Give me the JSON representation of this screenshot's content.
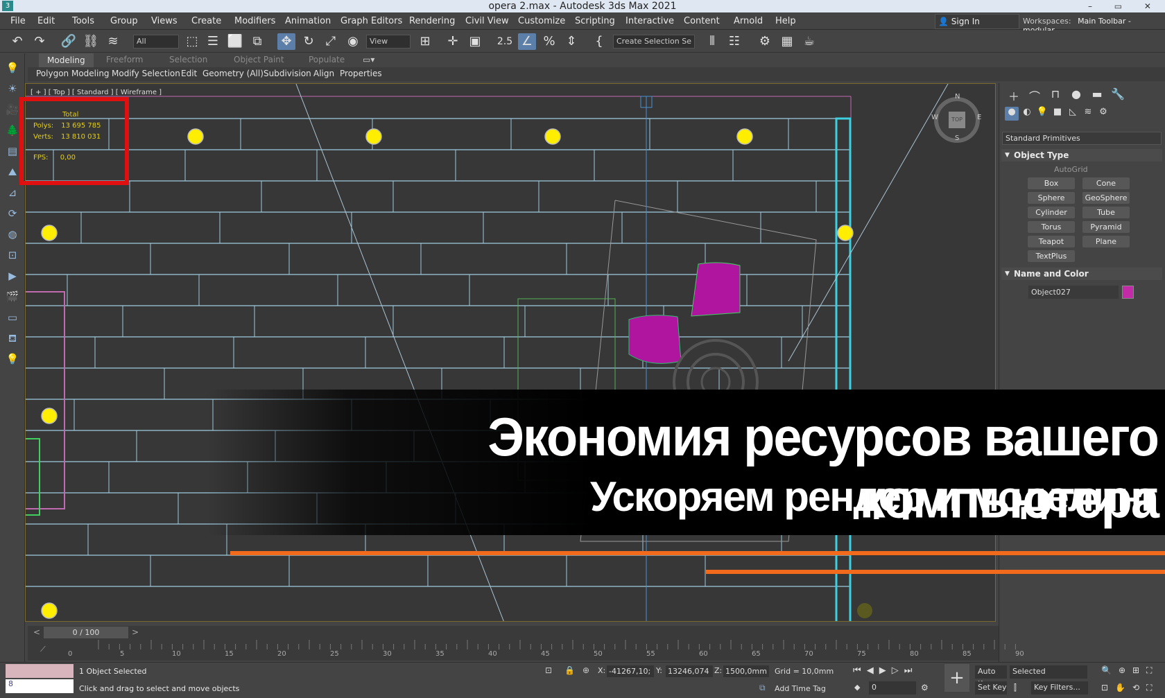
{
  "titlebar": {
    "title": "opera 2.max - Autodesk 3ds Max 2021",
    "app_icon": "3",
    "window_buttons": "– ▭ ✕"
  },
  "menu": [
    "File",
    "Edit",
    "Tools",
    "Group",
    "Views",
    "Create",
    "Modifiers",
    "Animation",
    "Graph Editors",
    "Rendering",
    "Civil View",
    "Customize",
    "Scripting",
    "Interactive",
    "Content",
    "Arnold",
    "Help"
  ],
  "account": {
    "sign_in": "Sign In",
    "workspaces_label": "Workspaces:",
    "workspace_value": "Main Toolbar - modular"
  },
  "toolbar": {
    "selection_filter": "All",
    "ref_coord": "View",
    "named_selection": "Create Selection Se",
    "snap_label": "2.5",
    "icons": [
      "undo-icon",
      "redo-icon",
      "link-icon",
      "unlink-icon",
      "bind-spacewarp-icon",
      "select-object-icon",
      "select-by-name-icon",
      "rect-selection-icon",
      "window-crossing-icon",
      "select-move-icon",
      "select-rotate-icon",
      "select-scale-icon",
      "select-place-icon",
      "use-pivot-icon",
      "snap-toggle-icon",
      "angle-snap-icon",
      "percent-snap-icon",
      "spinner-snap-icon",
      "edit-named-sets-icon",
      "mirror-icon",
      "align-icon",
      "render-setup-icon",
      "rendered-frame-icon",
      "render-icon"
    ]
  },
  "ribbon": {
    "tabs": [
      "Modeling",
      "Freeform",
      "Selection",
      "Object Paint",
      "Populate"
    ],
    "active_tab": "Modeling",
    "panels": [
      "Polygon Modeling",
      "Modify Selection",
      "Edit",
      "Geometry (All)",
      "Subdivision",
      "Align",
      "Properties"
    ]
  },
  "viewport": {
    "label": "[ + ] [ Top ] [ Standard ] [ Wireframe ]",
    "stats": {
      "total_label": "Total",
      "polys_label": "Polys:",
      "polys_value": "13 695 785",
      "verts_label": "Verts:",
      "verts_value": "13 810 031",
      "fps_label": "FPS:",
      "fps_value": "0,00"
    },
    "viewcube": {
      "top": "TOP",
      "n": "N",
      "s": "S",
      "e": "E",
      "w": "W"
    }
  },
  "command_panel": {
    "category": "Standard Primitives",
    "object_type_title": "Object Type",
    "autogrid": "AutoGrid",
    "primitives": [
      "Box",
      "Cone",
      "Sphere",
      "GeoSphere",
      "Cylinder",
      "Tube",
      "Torus",
      "Pyramid",
      "Teapot",
      "Plane",
      "TextPlus"
    ],
    "name_color_title": "Name and Color",
    "object_name": "Object027",
    "object_color": "#c22aa8"
  },
  "timeline": {
    "slider": "0 / 100",
    "ticks": [
      "0",
      "5",
      "10",
      "15",
      "20",
      "25",
      "30",
      "35",
      "40",
      "45",
      "50",
      "55",
      "60",
      "65",
      "70",
      "75",
      "80",
      "85",
      "90"
    ]
  },
  "status": {
    "mxs_value": "8",
    "selection": "1 Object Selected",
    "prompt": "Click and drag to select and move objects",
    "x_label": "X:",
    "x_value": "-41267,10;",
    "y_label": "Y:",
    "y_value": "13246,074",
    "z_label": "Z:",
    "z_value": "1500,0mm",
    "grid": "Grid = 10,0mm",
    "add_time_tag": "Add Time Tag",
    "auto_key": "Auto K...",
    "set_key": "Set Key",
    "selected_dd": "Selected",
    "key_filters": "Key Filters...",
    "frame_value": "0"
  },
  "banner": {
    "title": "Экономия ресурсов вашего компьютера",
    "subtitle": "Ускоряем рендер и моделинг",
    "accent": "#f26a1b"
  }
}
